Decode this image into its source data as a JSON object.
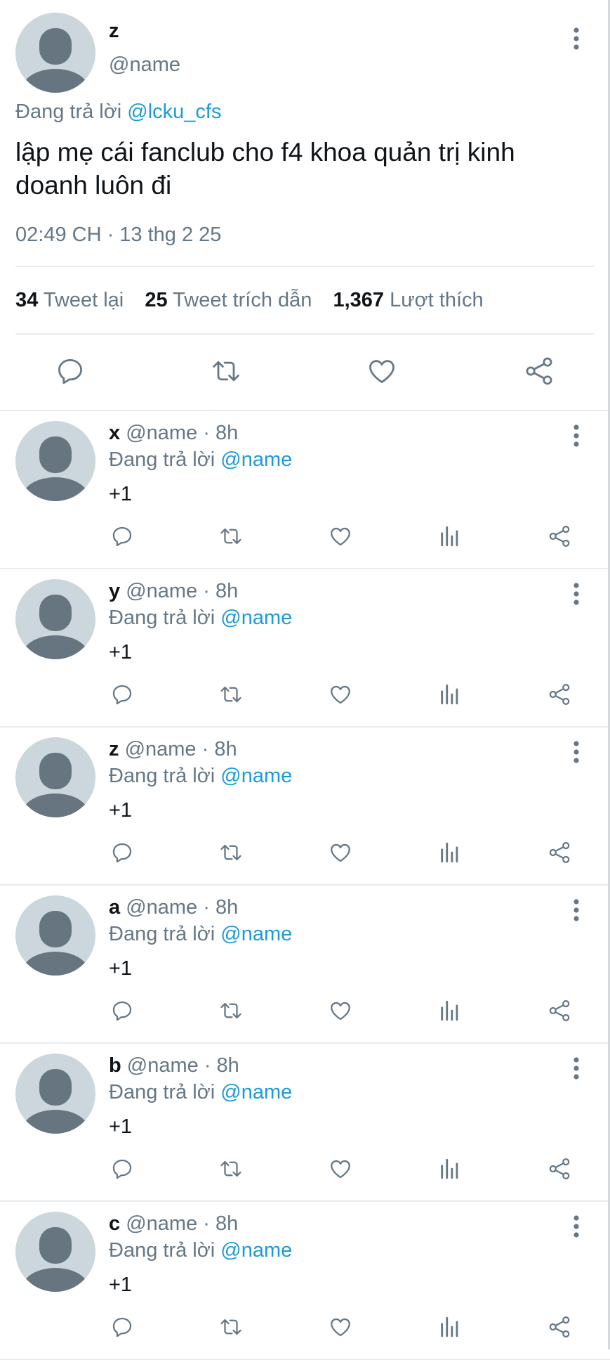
{
  "tweet": {
    "name": "z",
    "handle": "@name",
    "replying_prefix": "Đang trả lời",
    "replying_to": "@lcku_cfs",
    "text": "lập mẹ cái fanclub cho f4 khoa quản trị kinh doanh luôn đi",
    "timestamp": "02:49 CH · 13 thg 2 25",
    "stats": {
      "retweets_count": "34",
      "retweets_label": "Tweet lại",
      "quotes_count": "25",
      "quotes_label": "Tweet trích dẫn",
      "likes_count": "1,367",
      "likes_label": "Lượt thích"
    },
    "actions": [
      "reply-icon",
      "retweet-icon",
      "like-icon",
      "share-icon"
    ]
  },
  "replies": [
    {
      "name": "x",
      "handle": "@name",
      "sep": " · ",
      "time": "8h",
      "replying_prefix": "Đang trả lời",
      "replying_to": "@name",
      "text": "+1"
    },
    {
      "name": "y",
      "handle": "@name",
      "sep": " · ",
      "time": "8h",
      "replying_prefix": "Đang trả lời",
      "replying_to": "@name",
      "text": "+1"
    },
    {
      "name": "z",
      "handle": "@name",
      "sep": " · ",
      "time": "8h",
      "replying_prefix": "Đang trả lời",
      "replying_to": "@name",
      "text": "+1"
    },
    {
      "name": "a",
      "handle": "@name",
      "sep": " · ",
      "time": "8h",
      "replying_prefix": "Đang trả lời",
      "replying_to": "@name",
      "text": "+1"
    },
    {
      "name": "b",
      "handle": "@name",
      "sep": " · ",
      "time": "8h",
      "replying_prefix": "Đang trả lời",
      "replying_to": "@name",
      "text": "+1"
    },
    {
      "name": "c",
      "handle": "@name",
      "sep": " · ",
      "time": "8h",
      "replying_prefix": "Đang trả lời",
      "replying_to": "@name",
      "text": "+1"
    }
  ],
  "reply_actions": [
    "reply-icon",
    "retweet-icon",
    "like-icon",
    "analytics-icon",
    "share-icon"
  ],
  "colors": {
    "text": "#0f1419",
    "secondary": "#657786",
    "link": "#1d9bd8",
    "avatar_bg": "#ccd6dd",
    "avatar_fg": "#66757f",
    "divider": "#e6ecf0"
  }
}
